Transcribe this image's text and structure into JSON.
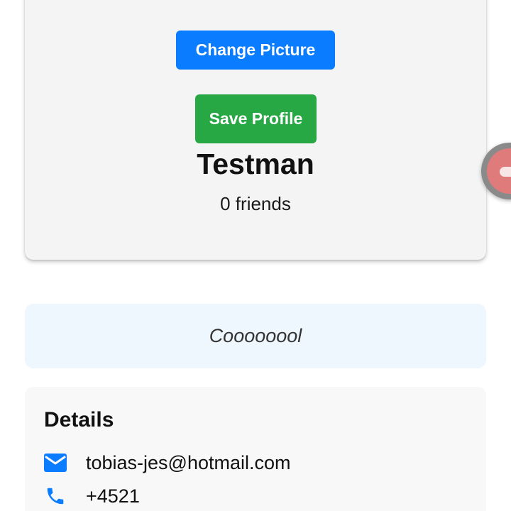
{
  "profile": {
    "change_picture_label": "Change Picture",
    "save_profile_label": "Save Profile",
    "name": "Testman",
    "friends_text": "0 friends"
  },
  "bio": {
    "text": "Coooooool"
  },
  "details": {
    "title": "Details",
    "email": "tobias-jes@hotmail.com",
    "phone": "+4521"
  },
  "icons": {
    "email": "mail-icon",
    "phone": "phone-icon"
  },
  "colors": {
    "primary_blue": "#0a7cff",
    "save_green": "#28a745",
    "bio_background": "#eef6fe",
    "card_background": "#f4f4f4"
  }
}
